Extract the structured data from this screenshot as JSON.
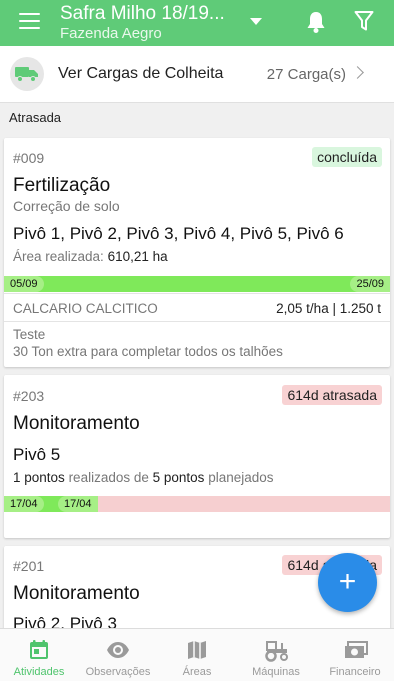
{
  "header": {
    "title": "Safra Milho 18/19...",
    "subtitle": "Fazenda Aegro"
  },
  "cargas": {
    "label": "Ver Cargas de Colheita",
    "count": "27 Carga(s)"
  },
  "section_label": "Atrasada",
  "cards": [
    {
      "code": "#009",
      "badge": "concluída",
      "type": "Fertilização",
      "subtype": "Correção de solo",
      "fields": "Pivô 1, Pivô 2, Pivô 3, Pivô 4, Pivô 5, Pivô 6",
      "area_label": "Área realizada:",
      "area_value": "610,21 ha",
      "start_date": "05/09",
      "end_date": "25/09",
      "progress": 1.0,
      "input_name": "CALCARIO CALCITICO",
      "input_qty": "2,05 t/ha | 1.250 t",
      "notes_title": "Teste",
      "notes_text": "30 Ton extra para completar todos os talhões"
    },
    {
      "code": "#203",
      "badge": "614d atrasada",
      "type": "Monitoramento",
      "fields": "Pivô 5",
      "done_count": "1 pontos",
      "done_label": "realizados de",
      "planned_count": "5 pontos",
      "planned_label": "planejados",
      "start_date": "17/04",
      "end_date": "17/04",
      "progress": 0.2
    },
    {
      "code": "#201",
      "badge": "614d atrasada",
      "type": "Monitoramento",
      "fields": "Pivô 2, Pivô 3"
    }
  ],
  "fab": {
    "label": "+"
  },
  "nav": {
    "items": [
      {
        "label": "Atividades",
        "icon": "calendar-icon",
        "active": true
      },
      {
        "label": "Observações",
        "icon": "eye-icon",
        "active": false
      },
      {
        "label": "Áreas",
        "icon": "map-icon",
        "active": false
      },
      {
        "label": "Máquinas",
        "icon": "tractor-icon",
        "active": false
      },
      {
        "label": "Financeiro",
        "icon": "money-icon",
        "active": false
      }
    ]
  },
  "colors": {
    "primary": "#5fcb78",
    "progress_fill": "#7fe95a",
    "progress_track_late": "#f6cfd0",
    "badge_done": "#d9f6de",
    "badge_late": "#f8d2d3",
    "fab": "#2a8ce8",
    "nav_active": "#4fc46d"
  }
}
